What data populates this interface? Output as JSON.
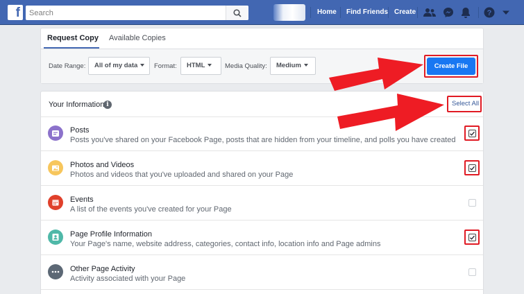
{
  "topbar": {
    "logo": "f",
    "search_placeholder": "Search",
    "nav": [
      "Home",
      "Find Friends",
      "Create"
    ],
    "icons": [
      "friends-icon",
      "messenger-icon",
      "notifications-icon",
      "help-icon",
      "dropdown-icon"
    ]
  },
  "tabs": [
    {
      "label": "Request Copy",
      "active": true
    },
    {
      "label": "Available Copies",
      "active": false
    }
  ],
  "filters": {
    "date_range_label": "Date Range:",
    "date_range_value": "All of my data",
    "format_label": "Format:",
    "format_value": "HTML",
    "media_quality_label": "Media Quality:",
    "media_quality_value": "Medium",
    "create_file": "Create File"
  },
  "info": {
    "title": "Your Information",
    "select_all": "Select All",
    "items": [
      {
        "title": "Posts",
        "desc": "Posts you've shared on your Facebook Page, posts that are hidden from your timeline, and polls you have created",
        "checked": true,
        "color": "#8c72cb",
        "icon": "posts-icon"
      },
      {
        "title": "Photos and Videos",
        "desc": "Photos and videos that you've uploaded and shared on your Page",
        "checked": true,
        "color": "#f7c65c",
        "icon": "photos-icon"
      },
      {
        "title": "Events",
        "desc": "A list of the events you've created for your Page",
        "checked": false,
        "color": "#e0402b",
        "icon": "events-icon"
      },
      {
        "title": "Page Profile Information",
        "desc": "Your Page's name, website address, categories, contact info, location info and Page admins",
        "checked": true,
        "color": "#4fb8a8",
        "icon": "profile-icon"
      },
      {
        "title": "Other Page Activity",
        "desc": "Activity associated with your Page",
        "checked": false,
        "color": "#5c6875",
        "icon": "more-icon"
      }
    ]
  },
  "colors": {
    "brand": "#4267b2",
    "primary_button": "#1877f2",
    "highlight": "#e01a23"
  }
}
